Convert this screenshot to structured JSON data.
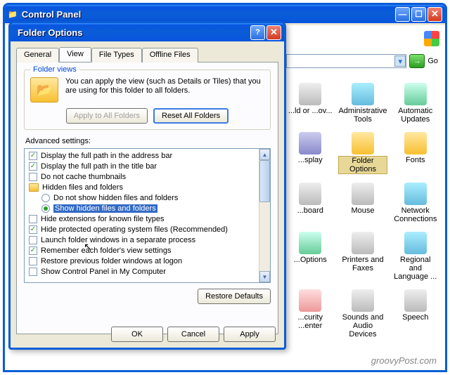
{
  "outer": {
    "title": "Control Panel",
    "go_label": "Go"
  },
  "cp_icons": [
    {
      "label": "...ld or\n...ov...",
      "g": "g6"
    },
    {
      "label": "Administrative Tools",
      "g": "g2"
    },
    {
      "label": "Automatic Updates",
      "g": "g3"
    },
    {
      "label": "...splay",
      "g": "g1"
    },
    {
      "label": "Folder Options",
      "g": "g4",
      "sel": true
    },
    {
      "label": "Fonts",
      "g": "g4"
    },
    {
      "label": "...board",
      "g": "g6"
    },
    {
      "label": "Mouse",
      "g": "g6"
    },
    {
      "label": "Network Connections",
      "g": "g2"
    },
    {
      "label": "...Options",
      "g": "g3"
    },
    {
      "label": "Printers and Faxes",
      "g": "g6"
    },
    {
      "label": "Regional and Language ...",
      "g": "g2"
    },
    {
      "label": "...curity\n...enter",
      "g": "g5"
    },
    {
      "label": "Sounds and Audio Devices",
      "g": "g6"
    },
    {
      "label": "Speech",
      "g": "g6"
    }
  ],
  "dialog": {
    "title": "Folder Options",
    "tabs": [
      "General",
      "View",
      "File Types",
      "Offline Files"
    ],
    "active_tab": 1,
    "folder_views": {
      "legend": "Folder views",
      "text": "You can apply the view (such as Details or Tiles) that you are using for this folder to all folders.",
      "apply_btn": "Apply to All Folders",
      "reset_btn": "Reset All Folders"
    },
    "advanced_label": "Advanced settings:",
    "tree": [
      {
        "type": "check",
        "checked": true,
        "label": "Display the full path in the address bar"
      },
      {
        "type": "check",
        "checked": true,
        "label": "Display the full path in the title bar"
      },
      {
        "type": "check",
        "checked": false,
        "label": "Do not cache thumbnails"
      },
      {
        "type": "folder",
        "label": "Hidden files and folders"
      },
      {
        "type": "radio",
        "checked": false,
        "indent": 1,
        "label": "Do not show hidden files and folders"
      },
      {
        "type": "radio",
        "checked": true,
        "indent": 1,
        "label": "Show hidden files and folders",
        "selected": true
      },
      {
        "type": "check",
        "checked": false,
        "label": "Hide extensions for known file types"
      },
      {
        "type": "check",
        "checked": true,
        "label": "Hide protected operating system files (Recommended)"
      },
      {
        "type": "check",
        "checked": false,
        "label": "Launch folder windows in a separate process"
      },
      {
        "type": "check",
        "checked": true,
        "label": "Remember each folder's view settings"
      },
      {
        "type": "check",
        "checked": false,
        "label": "Restore previous folder windows at logon"
      },
      {
        "type": "check",
        "checked": false,
        "label": "Show Control Panel in My Computer"
      }
    ],
    "restore_btn": "Restore Defaults",
    "ok_btn": "OK",
    "cancel_btn": "Cancel",
    "apply_btn": "Apply"
  },
  "watermark": "groovyPost.com"
}
